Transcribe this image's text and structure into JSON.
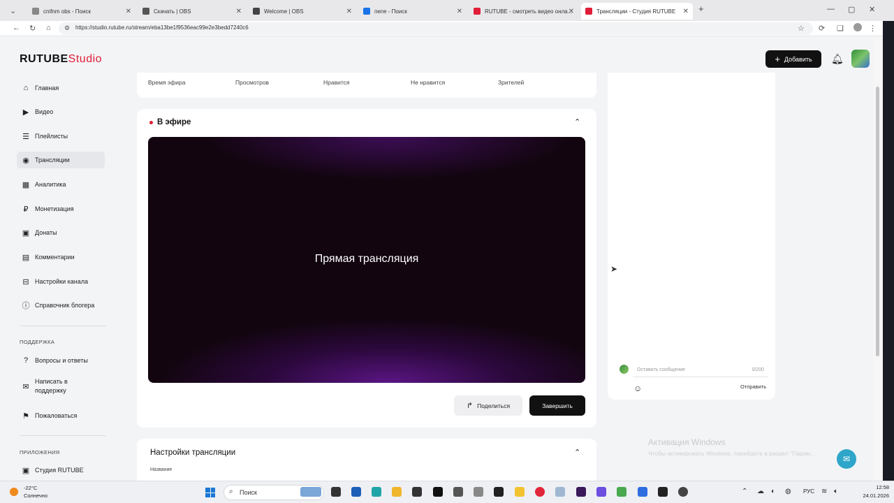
{
  "browser": {
    "tabs": [
      {
        "label": "cnifnm obs - Поиск",
        "favicon_color": "#888888"
      },
      {
        "label": "Скачать | OBS",
        "favicon_color": "#555555"
      },
      {
        "label": "Welcome | OBS",
        "favicon_color": "#444444"
      },
      {
        "label": "пепе - Поиск",
        "favicon_color": "#1a73e8"
      },
      {
        "label": "RUTUBE - смотреть видео онла...",
        "favicon_color": "#e01e37"
      },
      {
        "label": "Трансляции - Студия RUTUBE",
        "favicon_color": "#e01e37",
        "active": true
      }
    ],
    "url": "https://studio.rutube.ru/stream/eba13be1f9536eac99e2e3bedd7240c6"
  },
  "app": {
    "logo_main": "RUTUBE",
    "logo_studio": "Studio",
    "add_label": "Добавить",
    "sidebar": {
      "items": [
        {
          "label": "Главная",
          "icon": "home-icon"
        },
        {
          "label": "Видео",
          "icon": "video-icon"
        },
        {
          "label": "Плейлисты",
          "icon": "playlist-icon"
        },
        {
          "label": "Трансляции",
          "icon": "broadcast-icon",
          "active": true
        },
        {
          "label": "Аналитика",
          "icon": "analytics-icon"
        },
        {
          "label": "Монетизация",
          "icon": "ruble-icon"
        },
        {
          "label": "Донаты",
          "icon": "donate-icon"
        },
        {
          "label": "Комментарии",
          "icon": "comment-icon"
        },
        {
          "label": "Настройки канала",
          "icon": "settings-icon"
        },
        {
          "label": "Справочник блогера",
          "icon": "info-icon"
        }
      ],
      "support_heading": "ПОДДЕРЖКА",
      "support_items": [
        {
          "label": "Вопросы и ответы",
          "icon": "question-icon"
        },
        {
          "label": "Написать в поддержку",
          "icon": "mail-icon"
        },
        {
          "label": "Пожаловаться",
          "icon": "flag-icon"
        }
      ],
      "apps_heading": "ПРИЛОЖЕНИЯ",
      "apps_items": [
        {
          "label": "Студия RUTUBE",
          "icon": "studio-app-icon"
        }
      ]
    },
    "stats": {
      "labels": [
        "Время эфира",
        "Просмотров",
        "Нравится",
        "Не нравится",
        "Зрителей"
      ]
    },
    "live": {
      "title": "В эфире",
      "player_label": "Прямая трансляция",
      "share_label": "Поделиться",
      "end_label": "Завершить"
    },
    "settings": {
      "title": "Настройки трансляции",
      "name_label": "Название"
    },
    "chat": {
      "placeholder": "Оставить сообщение",
      "counter": "0/200",
      "send_label": "Отправить"
    }
  },
  "watermark": {
    "line1": "Активация Windows",
    "line2": "Чтобы активировать Windows, перейдите в раздел \"Парам..."
  },
  "taskbar": {
    "weather_temp": "-22°C",
    "weather_desc": "Солнечно",
    "search_label": "Поиск",
    "lang": "РУС",
    "time": "12:58",
    "date": "24.01.2026"
  }
}
